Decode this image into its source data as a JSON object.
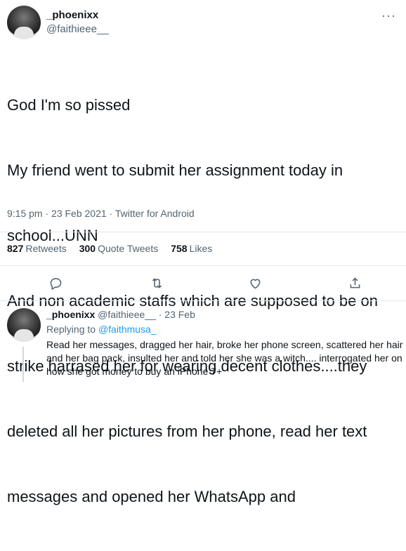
{
  "tweet": {
    "display_name": "_phoenixx",
    "handle": "@faithieee__",
    "more_icon": "ellipsis-icon",
    "text_lines": [
      "God I'm so pissed",
      "My friend went to submit her assignment today in",
      "school...UNN",
      "And non academic staffs which are supposed to be on",
      "strike harrased her for wearing decent clothes....they",
      "deleted all her pictures from her phone, read her text",
      "messages and opened her WhatsApp and"
    ],
    "timestamp": "9:15 pm · 23 Feb 2021 · Twitter for Android",
    "stats": {
      "retweets_count": "827",
      "retweets_label": "Retweets",
      "quotes_count": "300",
      "quotes_label": "Quote Tweets",
      "likes_count": "758",
      "likes_label": "Likes"
    },
    "actions": [
      "reply-icon",
      "retweet-icon",
      "like-icon",
      "share-icon"
    ]
  },
  "reply": {
    "display_name": "_phoenixx",
    "handle_time": "@faithieee__ · 23 Feb",
    "replying_prefix": "Replying to",
    "replying_to": "@faithmusa_",
    "text": "Read her messages, dragged her hair, broke her phone screen, scattered her hair and her bag pack, insulted her and told her she was a witch.... interrogated her on how she got money to buy an iPhone 7+"
  },
  "colors": {
    "text": "#0f1419",
    "secondary": "#536471",
    "link": "#1d9bf0",
    "divider": "#e4e8eb"
  }
}
